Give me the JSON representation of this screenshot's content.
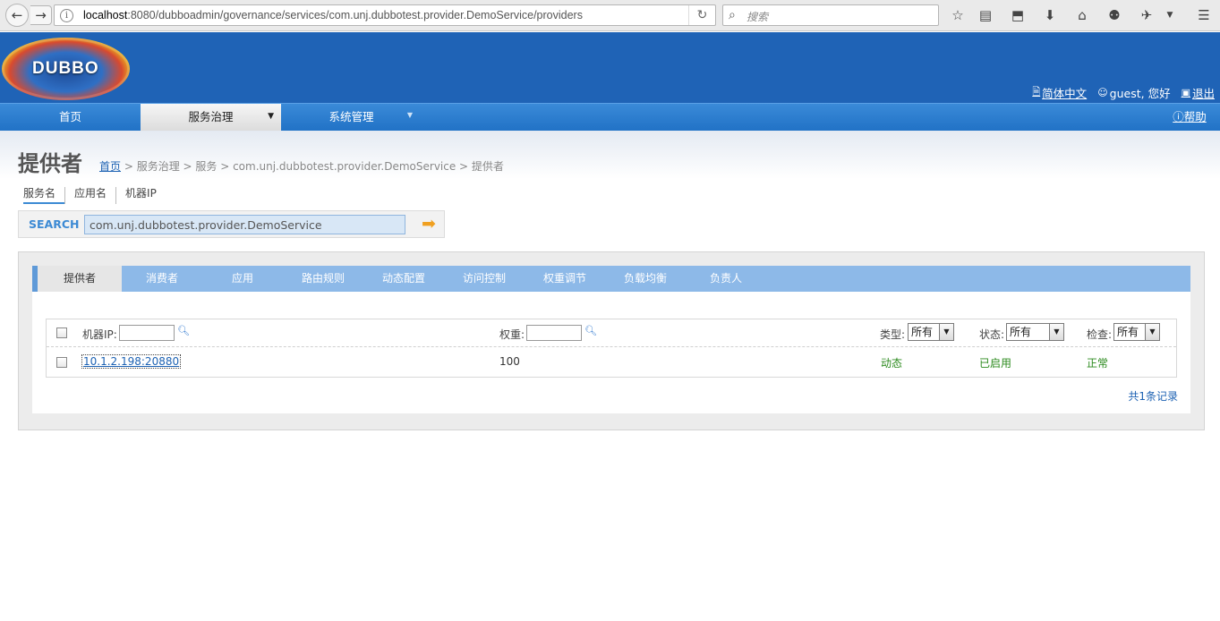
{
  "browser": {
    "url_host": "localhost",
    "url_rest": ":8080/dubboadmin/governance/services/com.unj.dubbotest.provider.DemoService/providers",
    "search_placeholder": "搜索"
  },
  "header": {
    "logo_text": "DUBBO",
    "lang_link": "简体中文",
    "greeting": "guest, 您好",
    "logout": "退出"
  },
  "nav": {
    "home": "首页",
    "governance": "服务治理",
    "system": "系统管理",
    "help": "帮助"
  },
  "page": {
    "title": "提供者",
    "breadcrumb_home": "首页",
    "breadcrumb_rest": " > 服务治理 > 服务 > com.unj.dubbotest.provider.DemoService > 提供者"
  },
  "search": {
    "tabs": [
      "服务名",
      "应用名",
      "机器IP"
    ],
    "label": "SEARCH",
    "value": "com.unj.dubbotest.provider.DemoService"
  },
  "content_tabs": [
    "提供者",
    "消费者",
    "应用",
    "路由规则",
    "动态配置",
    "访问控制",
    "权重调节",
    "负载均衡",
    "负责人"
  ],
  "table": {
    "filters": {
      "ip_label": "机器IP:",
      "weight_label": "权重:",
      "type_label": "类型:",
      "type_value": "所有",
      "status_label": "状态:",
      "status_value": "所有",
      "check_label": "检查:",
      "check_value": "所有"
    },
    "rows": [
      {
        "address": "10.1.2.198:20880",
        "weight": "100",
        "type": "动态",
        "status": "已启用",
        "check": "正常"
      }
    ],
    "record_count": "共1条记录"
  }
}
